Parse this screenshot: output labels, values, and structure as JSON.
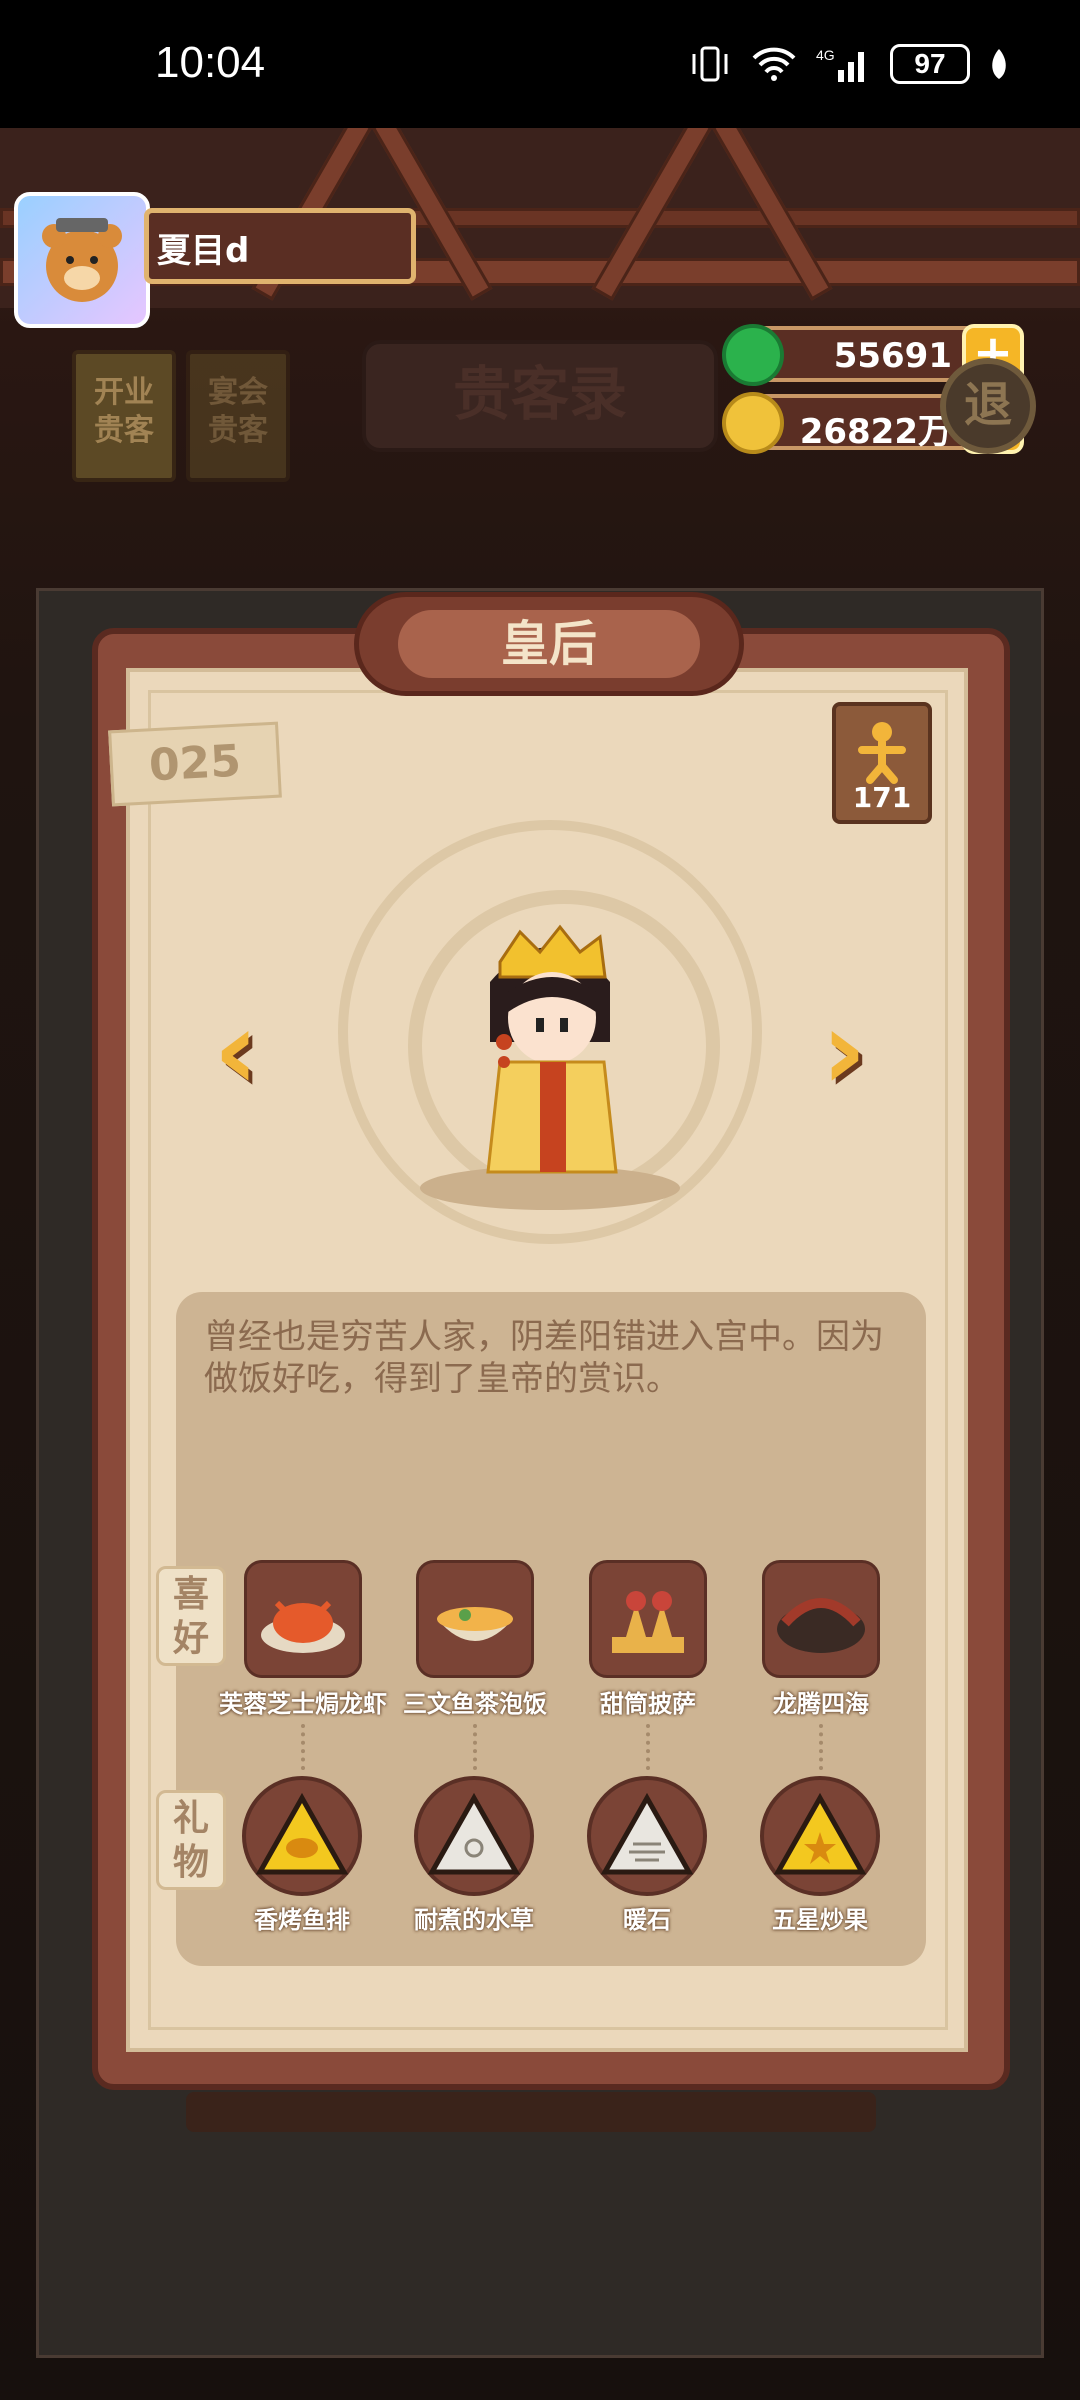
{
  "status_bar": {
    "time": "10:04",
    "battery": "97"
  },
  "player": {
    "name": "夏目d"
  },
  "currency": {
    "jade": "55691",
    "coins": "26822万"
  },
  "tabs": {
    "open_guests": "开业\n贵客",
    "banquet_guests": "宴会\n贵客"
  },
  "panel_title": "贵客录",
  "exit_label": "退",
  "guest": {
    "name": "皇后",
    "number": "025",
    "count": "171",
    "description": "曾经也是穷苦人家，阴差阳错进入宫中。因为做饭好吃，得到了皇帝的赏识。"
  },
  "labels": {
    "favorites": "喜\n好",
    "gifts": "礼\n物"
  },
  "favorites": [
    {
      "name": "芙蓉芝士焗龙虾"
    },
    {
      "name": "三文鱼茶泡饭"
    },
    {
      "name": "甜筒披萨"
    },
    {
      "name": "龙腾四海"
    }
  ],
  "gifts": [
    {
      "name": "香烤鱼排",
      "color": "#f3c81f"
    },
    {
      "name": "耐煮的水草",
      "color": "#e9e6e0"
    },
    {
      "name": "暖石",
      "color": "#e9e6e0"
    },
    {
      "name": "五星炒果",
      "color": "#f3c81f"
    }
  ],
  "colors": {
    "accent": "#f2b53a",
    "paper": "#ebd8bb",
    "frame": "#8a4a3a"
  }
}
